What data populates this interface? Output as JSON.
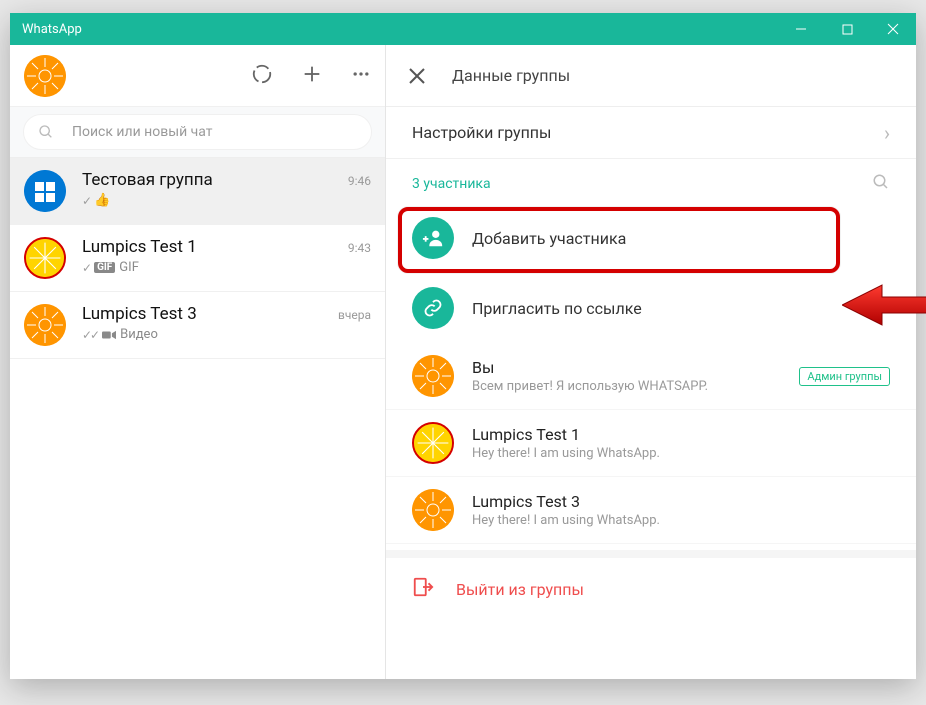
{
  "window": {
    "title": "WhatsApp"
  },
  "left": {
    "search_placeholder": "Поиск или новый чат",
    "chats": [
      {
        "name": "Тестовая группа",
        "time": "9:46",
        "sub_extra": "👍",
        "ticks": "✓"
      },
      {
        "name": "Lumpics Test 1",
        "time": "9:43",
        "sub_extra": "GIF",
        "ticks": "✓"
      },
      {
        "name": "Lumpics Test 3",
        "time": "вчера",
        "sub_extra": "Видео",
        "ticks": "✓✓"
      }
    ]
  },
  "right": {
    "title": "Данные группы",
    "settings_label": "Настройки группы",
    "participants_count": "3 участника",
    "add_participant": "Добавить участника",
    "invite_link": "Пригласить по ссылке",
    "participants": [
      {
        "name": "Вы",
        "status": "Всем привет! Я использую WHATSAPP.",
        "admin": "Админ группы"
      },
      {
        "name": "Lumpics Test 1",
        "status": "Hey there! I am using WhatsApp."
      },
      {
        "name": "Lumpics Test 3",
        "status": "Hey there! I am using WhatsApp."
      }
    ],
    "exit_group": "Выйти из группы"
  }
}
